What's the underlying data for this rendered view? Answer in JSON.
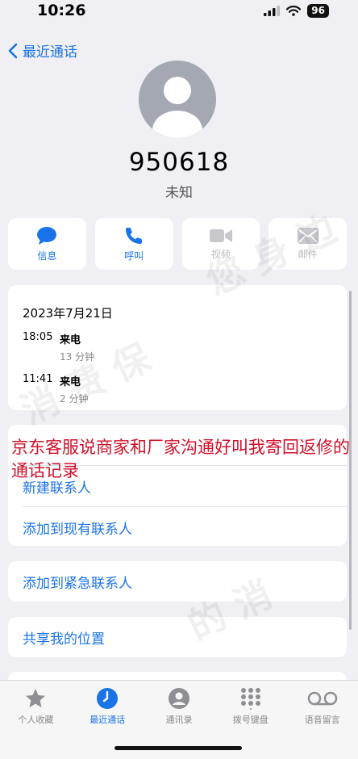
{
  "status": {
    "time": "10:26",
    "battery": "96"
  },
  "nav": {
    "back_label": "最近通话"
  },
  "caller": {
    "number": "950618",
    "label": "未知"
  },
  "actions": [
    {
      "label": "信息",
      "icon": "message-icon",
      "enabled": true
    },
    {
      "label": "呼叫",
      "icon": "phone-icon",
      "enabled": true
    },
    {
      "label": "视频",
      "icon": "video-icon",
      "enabled": false
    },
    {
      "label": "邮件",
      "icon": "mail-icon",
      "enabled": false
    }
  ],
  "history": {
    "date": "2023年7月21日",
    "calls": [
      {
        "time": "18:05",
        "kind": "来电",
        "duration": "13 分钟"
      },
      {
        "time": "11:41",
        "kind": "来电",
        "duration": "2 分钟"
      }
    ]
  },
  "contact_options": {
    "new_contact": "新建联系人",
    "add_existing": "添加到现有联系人"
  },
  "emergency": "添加到紧急联系人",
  "share_location": "共享我的位置",
  "overlay_text": "京东客服说商家和厂家沟通好叫我寄回返修的通话记录",
  "tabs": [
    {
      "label": "个人收藏",
      "icon": "star-icon",
      "active": false
    },
    {
      "label": "最近通话",
      "icon": "clock-icon",
      "active": true
    },
    {
      "label": "通讯录",
      "icon": "contacts-icon",
      "active": false
    },
    {
      "label": "拨号键盘",
      "icon": "keypad-icon",
      "active": false
    },
    {
      "label": "语音留言",
      "icon": "voicemail-icon",
      "active": false
    }
  ],
  "colors": {
    "accent": "#1a73e8",
    "overlay": "#d0102a",
    "background": "#efeff4"
  }
}
